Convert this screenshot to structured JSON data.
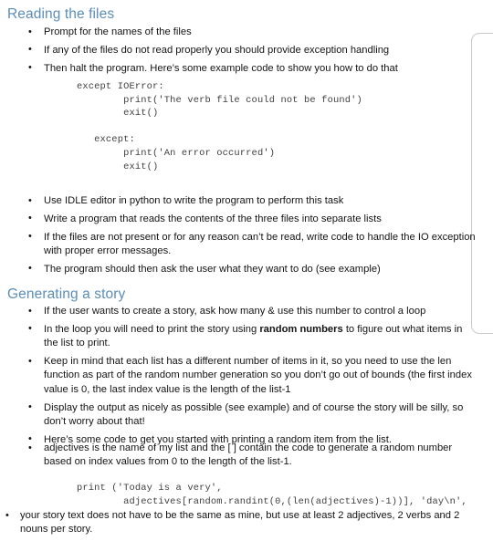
{
  "document": {
    "sections": [
      {
        "heading": "Reading the files",
        "bullets_top": [
          "Prompt for the names of the files",
          "If any of the files do not read properly you should provide exception handling",
          "Then halt the program. Here’s some example code to show you how to do that"
        ],
        "code": "except IOError:\n        print('The verb file could not be found')\n        exit()\n\n   except:\n        print('An error occurred')\n        exit()",
        "bullets_bottom": [
          "Use IDLE editor in python to write the program to perform this task",
          "Write a program that reads the contents of the three files into separate lists",
          "If the files are not present or for any reason can’t be read, write code to handle the IO exception with proper error messages.",
          "The program should then ask the user what they want to do (see example)"
        ]
      },
      {
        "heading": "Generating a story",
        "bullets_top": [
          "If the user wants to create a story, ask how many & use this number to control a loop",
          "Keep in mind that each list has a different number of items in it, so you need to use the len function as part of the random number generation so you don’t go out of bounds (the first index value is 0, the last index value is the length of the list-1",
          "Display the output as nicely as possible (see example) and of course the story will be silly, so don’t worry about that!",
          "Here’s some code to get you started with printing a random item from the list."
        ],
        "bullet_rich": {
          "part1": "In the loop you will need to print the story using ",
          "bold": "random numbers",
          "part2": " to figure out what items in the list to print."
        },
        "bullet_adjectives": "adjectives is the name of my list and the [ ] contain the code to generate a random number based on index values from 0 to the length of the list-1.",
        "code": "print ('Today is a very',\n        adjectives[random.randint(0,(len(adjectives)-1))], 'day\\n',",
        "bullet_final": "your story text does not have to be the same as mine, but use at least 2 adjectives, 2 verbs and 2 nouns per story."
      }
    ],
    "colors": {
      "heading": "#5b8db8",
      "body_text": "#141414",
      "code_text": "#404040",
      "panel_border": "#c9c9c9",
      "background": "#ffffff"
    }
  }
}
